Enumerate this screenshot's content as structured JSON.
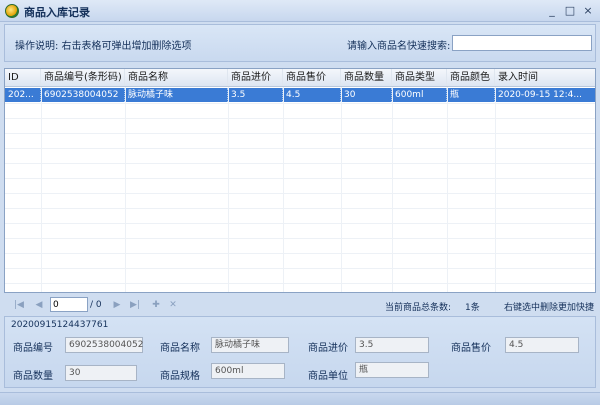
{
  "window": {
    "title": "商品入库记录",
    "minimize": "_",
    "maximize": "□",
    "close": "×"
  },
  "top": {
    "instructions": "操作说明: 右击表格可弹出增加删除选项",
    "search_label": "请输入商品名快速搜索:",
    "search_value": ""
  },
  "grid": {
    "columns": [
      "ID",
      "商品编号(条形码)",
      "商品名称",
      "商品进价",
      "商品售价",
      "商品数量",
      "商品类型",
      "商品颜色",
      "录入时间"
    ],
    "rows": [
      {
        "id": "202...",
        "barcode": "6902538004052",
        "name": "脉动橘子味",
        "cost": "3.5",
        "price": "4.5",
        "qty": "30",
        "type": "600ml",
        "color": "瓶",
        "time": "2020-09-15 12:4..."
      }
    ]
  },
  "pager": {
    "first": "|◀",
    "prev": "◀",
    "page_value": "0",
    "total": "/ 0",
    "next": "▶",
    "last": "▶|",
    "add": "✚",
    "delete": "✕",
    "total_label": "当前商品总条数:",
    "total_count": "1条",
    "hint": "右键选中删除更加快捷"
  },
  "detail": {
    "record_id": "20200915124437761",
    "labels": {
      "barcode": "商品编号",
      "name": "商品名称",
      "cost": "商品进价",
      "price": "商品售价",
      "qty": "商品数量",
      "spec": "商品规格",
      "unit": "商品单位"
    },
    "values": {
      "barcode": "6902538004052",
      "name": "脉动橘子味",
      "cost": "3.5",
      "price": "4.5",
      "qty": "30",
      "spec": "600ml",
      "unit": "瓶"
    }
  }
}
